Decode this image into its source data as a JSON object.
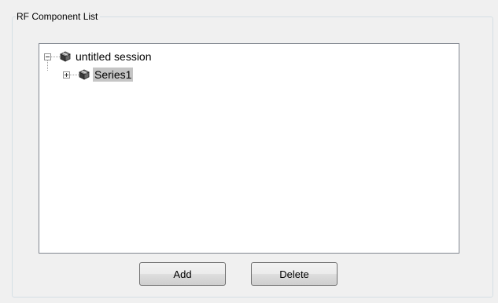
{
  "group": {
    "title": "RF Component List"
  },
  "tree": {
    "nodes": [
      {
        "label": "untitled session",
        "expander": "collapse",
        "icon": "component-cube-icon"
      },
      {
        "label": "Series1",
        "expander": "expand",
        "icon": "component-cube-icon",
        "selected": true
      }
    ]
  },
  "buttons": {
    "add_label": "Add",
    "delete_label": "Delete"
  }
}
